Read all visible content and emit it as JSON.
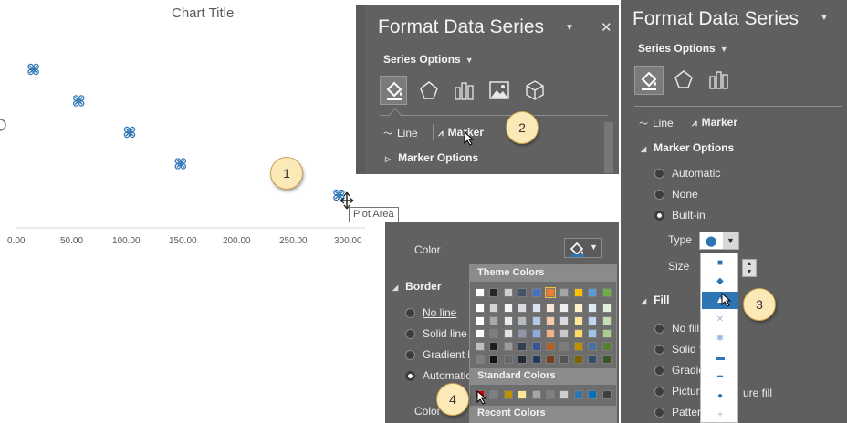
{
  "chart": {
    "title": "Chart Title",
    "x_tick_labels": [
      "0.00",
      "50.00",
      "100.00",
      "150.00",
      "200.00",
      "250.00",
      "300.00"
    ],
    "tooltip": "Plot Area",
    "series_color": "#2e75b6"
  },
  "chart_data": {
    "type": "scatter",
    "title": "Chart Title",
    "x": [
      15,
      55,
      100,
      145,
      285
    ],
    "y": [
      5,
      4,
      3,
      2,
      1
    ],
    "xlim": [
      0,
      300
    ],
    "grid": false
  },
  "callouts": [
    "1",
    "2",
    "3",
    "4"
  ],
  "pane_top": {
    "title": "Format Data Series",
    "series_options": "Series Options",
    "tab_line": "Line",
    "tab_marker": "Marker",
    "section": "Marker Options"
  },
  "pane_right": {
    "title": "Format Data Series",
    "series_options": "Series Options",
    "tab_line": "Line",
    "tab_marker": "Marker",
    "marker_options": "Marker Options",
    "radio_automatic": "Automatic",
    "radio_none": "None",
    "radio_builtin": "Built-in",
    "type_label": "Type",
    "size_label": "Size",
    "fill_section": "Fill",
    "fill_no_fill": "No fill",
    "fill_solid": "Solid f",
    "fill_gradient": "Gradie",
    "fill_picture_a": "Picture",
    "fill_picture_b": "ure fill",
    "fill_pattern": "Patter"
  },
  "pane_bottom": {
    "color_label": "Color",
    "border_section": "Border",
    "radio_no_line": "No line",
    "radio_solid_line": "Solid line",
    "radio_gradient": "Gradient l",
    "radio_automatic": "Automatic",
    "color_label_2": "Color"
  },
  "palette": {
    "theme_heading": "Theme Colors",
    "standard_heading": "Standard Colors",
    "recent_heading": "Recent Colors",
    "theme_top_row": [
      "#ffffff",
      "#262626",
      "#d0cece",
      "#44546a",
      "#4472c4",
      "#ed7d31",
      "#a5a5a5",
      "#ffc000",
      "#5b9bd5",
      "#70ad47"
    ],
    "standard_row": [
      "#c00000",
      "#7f7f7f",
      "#bf9000",
      "#ffe699",
      "#a6a6a6",
      "#808080",
      "#d0cece",
      "#2e75b6",
      "#0070c0",
      "#404040"
    ]
  },
  "icons": {
    "paint_bucket": "paint-bucket-icon",
    "pentagon": "pentagon-effects-icon",
    "bars": "bar-size-icon",
    "picture": "picture-icon",
    "cube": "3d-format-icon",
    "close": "close-icon",
    "dropdown": "chevron-down-icon"
  }
}
